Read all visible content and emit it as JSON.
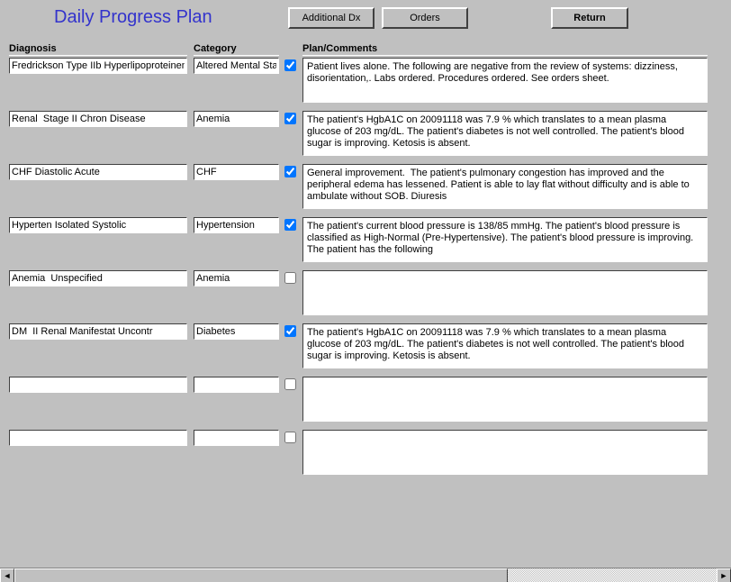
{
  "title": "Daily Progress Plan",
  "buttons": {
    "additional_dx": "Additional Dx",
    "orders": "Orders",
    "return": "Return"
  },
  "columns": {
    "diagnosis": "Diagnosis",
    "category": "Category",
    "plan": "Plan/Comments"
  },
  "rows": [
    {
      "diagnosis": "Fredrickson Type IIb Hyperlipoproteinem",
      "category": "Altered Mental Sta",
      "checked": true,
      "plan": "Patient lives alone. The following are negative from the review of systems: dizziness, disorientation,. Labs ordered. Procedures ordered. See orders sheet."
    },
    {
      "diagnosis": "Renal  Stage II Chron Disease",
      "category": "Anemia",
      "checked": true,
      "plan": "The patient's HgbA1C on 20091118 was 7.9 % which translates to a mean plasma glucose of 203 mg/dL. The patient's diabetes is not well controlled. The patient's blood sugar is improving. Ketosis is absent."
    },
    {
      "diagnosis": "CHF Diastolic Acute",
      "category": "CHF",
      "checked": true,
      "plan": "General improvement.  The patient's pulmonary congestion has improved and the peripheral edema has lessened. Patient is able to lay flat without difficulty and is able to ambulate without SOB. Diuresis"
    },
    {
      "diagnosis": "Hyperten Isolated Systolic",
      "category": "Hypertension",
      "checked": true,
      "plan": "The patient's current blood pressure is 138/85 mmHg. The patient's blood pressure is classified as High-Normal (Pre-Hypertensive). The patient's blood pressure is improving. The patient has the following"
    },
    {
      "diagnosis": "Anemia  Unspecified",
      "category": "Anemia",
      "checked": false,
      "plan": ""
    },
    {
      "diagnosis": "DM  II Renal Manifestat Uncontr",
      "category": "Diabetes",
      "checked": true,
      "plan": "The patient's HgbA1C on 20091118 was 7.9 % which translates to a mean plasma glucose of 203 mg/dL. The patient's diabetes is not well controlled. The patient's blood sugar is improving. Ketosis is absent."
    },
    {
      "diagnosis": "",
      "category": "",
      "checked": false,
      "plan": ""
    },
    {
      "diagnosis": "",
      "category": "",
      "checked": false,
      "plan": ""
    }
  ]
}
